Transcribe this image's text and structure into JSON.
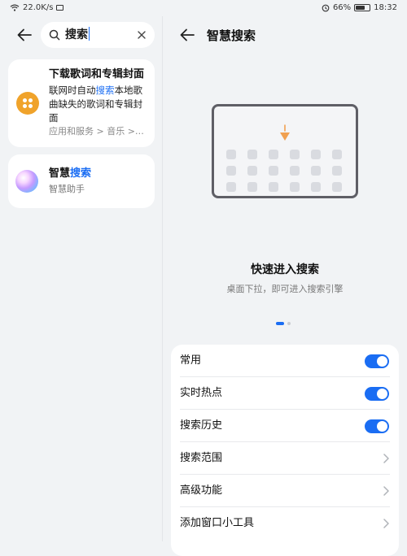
{
  "status_bar": {
    "net_speed": "22.0K/s",
    "battery": "66%",
    "time": "18:32",
    "battery_level": 0.66
  },
  "left_pane": {
    "search": {
      "query": "搜索"
    },
    "results": [
      {
        "title": "下载歌词和专辑封面",
        "desc_pre": "联网时自动",
        "desc_highlight": "搜索",
        "desc_post": "本地歌曲缺失的歌词和专辑封面",
        "path": "应用和服务 > 音乐 >…",
        "icon": "music-app-icon"
      },
      {
        "title_pre": "智慧",
        "title_highlight": "搜索",
        "subtitle": "智慧助手",
        "icon": "smart-assistant-orb-icon"
      }
    ]
  },
  "right_pane": {
    "title": "智慧搜索",
    "feature": {
      "title": "快速进入搜索",
      "subtitle": "桌面下拉，即可进入搜索引擎"
    },
    "pager": {
      "pages": 2,
      "current": 1
    },
    "settings": [
      {
        "label": "常用",
        "type": "toggle",
        "on": true
      },
      {
        "label": "实时热点",
        "type": "toggle",
        "on": true
      },
      {
        "label": "搜索历史",
        "type": "toggle",
        "on": true
      },
      {
        "label": "搜索范围",
        "type": "link"
      },
      {
        "label": "高级功能",
        "type": "link"
      },
      {
        "label": "添加窗口小工具",
        "type": "link"
      }
    ]
  },
  "colors": {
    "accent": "#1a6df3",
    "background": "#f1f3f5",
    "card": "#ffffff",
    "music_icon": "#f0a32b",
    "arrow": "#f0a050"
  }
}
